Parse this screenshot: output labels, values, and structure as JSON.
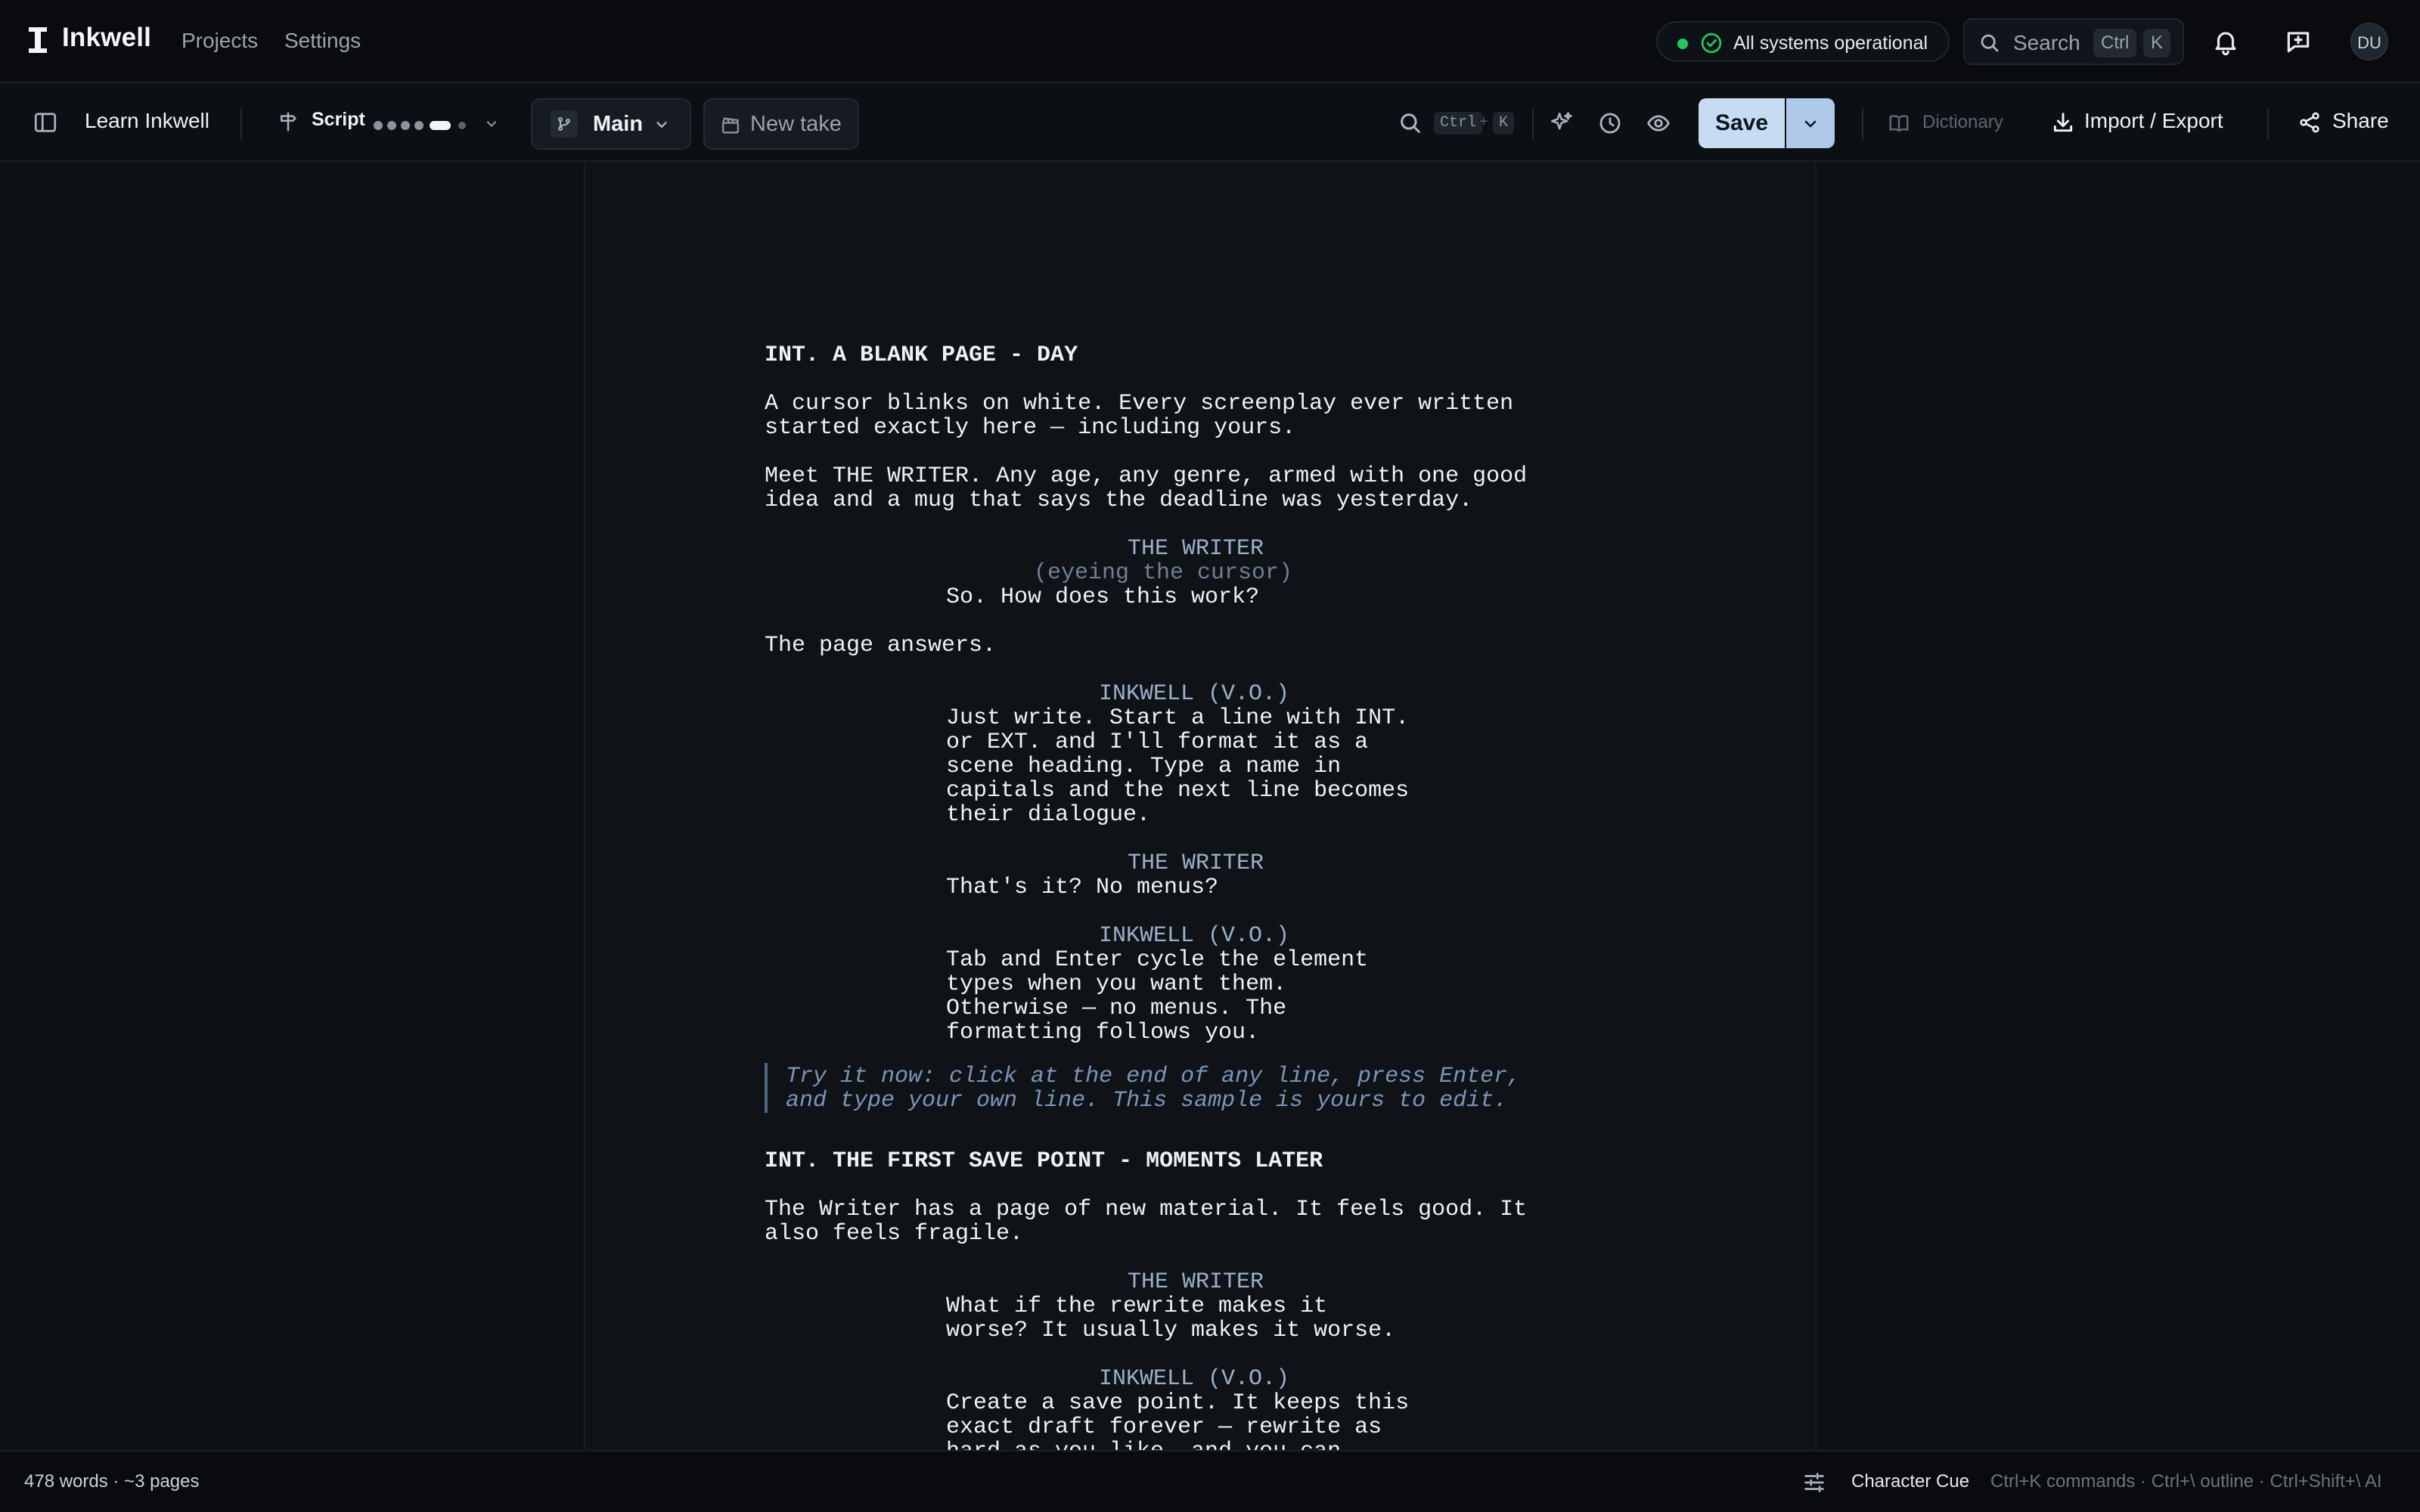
{
  "app": {
    "name": "Inkwell",
    "nav": [
      "Projects",
      "Settings"
    ]
  },
  "status": {
    "text": "All systems operational",
    "color": "#22c55e"
  },
  "search": {
    "label": "Search",
    "kbd1": "Ctrl",
    "kbd2": "K"
  },
  "user": {
    "initials": "DU"
  },
  "toolbar": {
    "project_title": "Learn Inkwell",
    "mode_label": "Script",
    "branch_label": "Main",
    "new_take_label": "New take",
    "find_kbd1": "Ctrl",
    "find_plus": "+",
    "find_kbd2": "K",
    "save_label": "Save",
    "dictionary_label": "Dictionary",
    "import_export_label": "Import / Export",
    "share_label": "Share"
  },
  "script": {
    "scene1_heading": "INT. A BLANK PAGE - DAY",
    "action1": [
      "A cursor blinks on white. Every screenplay ever written",
      "started exactly here — including yours."
    ],
    "action2": [
      "Meet THE WRITER. Any age, any genre, armed with one good",
      "idea and a mug that says the deadline was yesterday."
    ],
    "cue1": "THE WRITER",
    "paren1": "(eyeing the cursor)",
    "dialogue1": [
      "So. How does this work?"
    ],
    "action3": [
      "The page answers."
    ],
    "cue2": "INKWELL (V.O.)",
    "dialogue2": [
      "Just write. Start a line with INT.",
      "or EXT. and I'll format it as a",
      "scene heading. Type a name in",
      "capitals and the next line becomes",
      "their dialogue."
    ],
    "cue3": "THE WRITER",
    "dialogue3": [
      "That's it? No menus?"
    ],
    "cue4": "INKWELL (V.O.)",
    "dialogue4": [
      "Tab and Enter cycle the element",
      "types when you want them.",
      "Otherwise — no menus. The",
      "formatting follows you."
    ],
    "note": [
      "Try it now: click at the end of any line, press Enter,",
      "and type your own line. This sample is yours to edit."
    ],
    "scene2_heading": "INT. THE FIRST SAVE POINT - MOMENTS LATER",
    "action4": [
      "The Writer has a page of new material. It feels good. It",
      "also feels fragile."
    ],
    "cue5": "THE WRITER",
    "dialogue5": [
      "What if the rewrite makes it",
      "worse? It usually makes it worse."
    ],
    "cue6": "INKWELL (V.O.)",
    "dialogue6": [
      "Create a save point. It keeps this",
      "exact draft forever — rewrite as",
      "hard as you like, and you can"
    ]
  },
  "statusbar": {
    "stats": "478 words · ~3 pages",
    "element_type": "Character Cue",
    "hints": "Ctrl+K commands · Ctrl+\\ outline · Ctrl+Shift+\\ AI"
  }
}
